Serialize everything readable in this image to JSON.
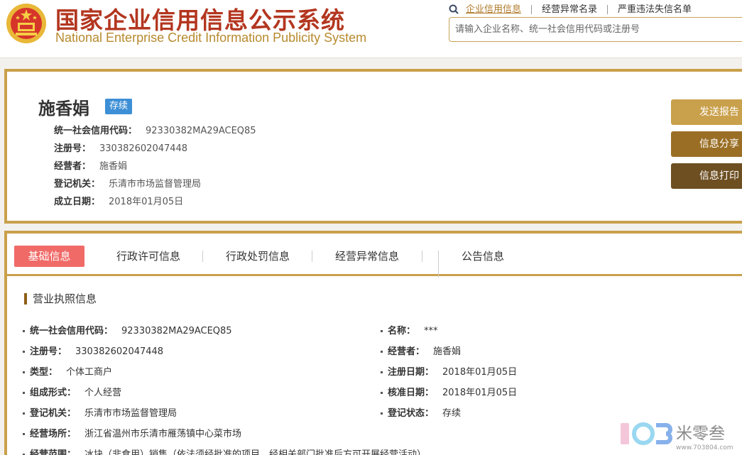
{
  "header": {
    "title_cn": "国家企业信用信息公示系统",
    "title_en": "National Enterprise Credit Information Publicity System",
    "nav": [
      "企业信用信息",
      "经营异常名录",
      "严重违法失信名单"
    ],
    "search_placeholder": "请输入企业名称、统一社会信用代码或注册号"
  },
  "company": {
    "name": "施香娟",
    "status": "存续",
    "rows": [
      {
        "label": "统一社会信用代码：",
        "value": "92330382MA29ACEQ85"
      },
      {
        "label": "注册号：",
        "value": "330382602047448"
      },
      {
        "label": "经营者：",
        "value": "施香娟"
      },
      {
        "label": "登记机关：",
        "value": "乐清市市场监督管理局"
      },
      {
        "label": "成立日期：",
        "value": "2018年01月05日"
      }
    ]
  },
  "actions": {
    "send": "发送报告",
    "share": "信息分享",
    "print": "信息打印"
  },
  "tabs": [
    "基础信息",
    "行政许可信息",
    "行政处罚信息",
    "经营异常信息",
    "公告信息"
  ],
  "section": {
    "title": "营业执照信息",
    "left": [
      {
        "label": "统一社会信用代码：",
        "value": "92330382MA29ACEQ85"
      },
      {
        "label": "注册号：",
        "value": "330382602047448"
      },
      {
        "label": "类型：",
        "value": "个体工商户"
      },
      {
        "label": "组成形式：",
        "value": "个人经营"
      },
      {
        "label": "登记机关：",
        "value": "乐清市市场监督管理局"
      },
      {
        "label": "经营场所：",
        "value": "浙江省温州市乐清市雁荡镇中心菜市场"
      },
      {
        "label": "经营范围：",
        "value": "冰块（非食用）销售（依法须经批准的项目，经相关部门批准后方可开展经营活动）"
      }
    ],
    "right": [
      {
        "label": "名称：",
        "value": "***"
      },
      {
        "label": "经营者：",
        "value": "施香娟"
      },
      {
        "label": "注册日期：",
        "value": "2018年01月05日"
      },
      {
        "label": "核准日期：",
        "value": "2018年01月05日"
      },
      {
        "label": "登记状态：",
        "value": "存续"
      }
    ]
  },
  "watermark": {
    "brand": "米零叁",
    "url": "www.703804.com"
  },
  "colors": {
    "gold": "#c9a04b",
    "red_title": "#b3361f",
    "active_tab": "#f06a67",
    "badge": "#3d8fd6"
  }
}
